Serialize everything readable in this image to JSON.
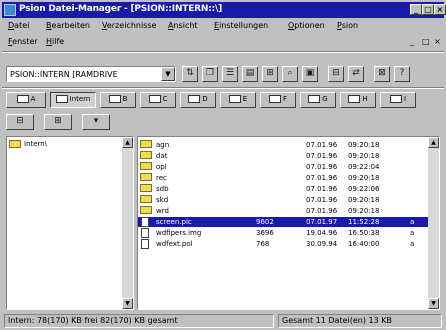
{
  "window": {
    "title": "Psion Datei-Manager - [PSION::INTERN::\\]",
    "minimize": "_",
    "maximize": "□",
    "close": "×"
  },
  "menu1": [
    "Datei",
    "Bearbeiten",
    "Verzeichnisse",
    "Ansicht",
    "Einstellungen",
    "Optionen",
    "Psion"
  ],
  "menu2": [
    "Fenster",
    "Hilfe"
  ],
  "mdi_buttons": [
    "_",
    "□",
    "×"
  ],
  "drive_select": {
    "value": "PSION::INTERN [RAMDRIVE"
  },
  "toolbar_icons": [
    "move-icon",
    "copy-icon",
    "list-view-icon",
    "details-view-icon",
    "tree-view-icon",
    "search-icon",
    "properties-icon",
    "network-icon",
    "connect-icon",
    "disconnect-icon",
    "help-icon"
  ],
  "drive_tabs": [
    {
      "label": "A",
      "active": false
    },
    {
      "label": "Intern",
      "active": true
    },
    {
      "label": "B",
      "active": false
    },
    {
      "label": "C",
      "active": false
    },
    {
      "label": "D",
      "active": false
    },
    {
      "label": "E",
      "active": false
    },
    {
      "label": "F",
      "active": false
    },
    {
      "label": "G",
      "active": false
    },
    {
      "label": "H",
      "active": false
    },
    {
      "label": "I",
      "active": false
    }
  ],
  "tree": {
    "root": "Intern\\"
  },
  "files": [
    {
      "name": "agn",
      "size": "",
      "date": "07.01.96",
      "time": "09:20:18",
      "attr": "",
      "type": "folder",
      "selected": false
    },
    {
      "name": "dat",
      "size": "",
      "date": "07.01.96",
      "time": "09:20:18",
      "attr": "",
      "type": "folder",
      "selected": false
    },
    {
      "name": "opl",
      "size": "",
      "date": "07.01.96",
      "time": "09:22:04",
      "attr": "",
      "type": "folder",
      "selected": false
    },
    {
      "name": "rec",
      "size": "",
      "date": "07.01.96",
      "time": "09:20:18",
      "attr": "",
      "type": "folder",
      "selected": false
    },
    {
      "name": "sdb",
      "size": "",
      "date": "07.01.96",
      "time": "09:22:06",
      "attr": "",
      "type": "folder",
      "selected": false
    },
    {
      "name": "skd",
      "size": "",
      "date": "07.01.96",
      "time": "09:20:18",
      "attr": "",
      "type": "folder",
      "selected": false
    },
    {
      "name": "wrd",
      "size": "",
      "date": "07.01.96",
      "time": "09:20:18",
      "attr": "",
      "type": "folder",
      "selected": false
    },
    {
      "name": "screen.pic",
      "size": "9602",
      "date": "07.01.97",
      "time": "11:52:28",
      "attr": "a",
      "type": "file",
      "selected": true
    },
    {
      "name": "wdfipers.img",
      "size": "3696",
      "date": "19.04.96",
      "time": "16:50:38",
      "attr": "a",
      "type": "file",
      "selected": false
    },
    {
      "name": "wdfext.pol",
      "size": "768",
      "date": "30.09.94",
      "time": "16:40:00",
      "attr": "a",
      "type": "file",
      "selected": false
    }
  ],
  "status": {
    "left": "Intern: 78(170) KB frei 82(170) KB gesamt",
    "right": "Gesamt 11 Datei(en) 13 KB"
  }
}
